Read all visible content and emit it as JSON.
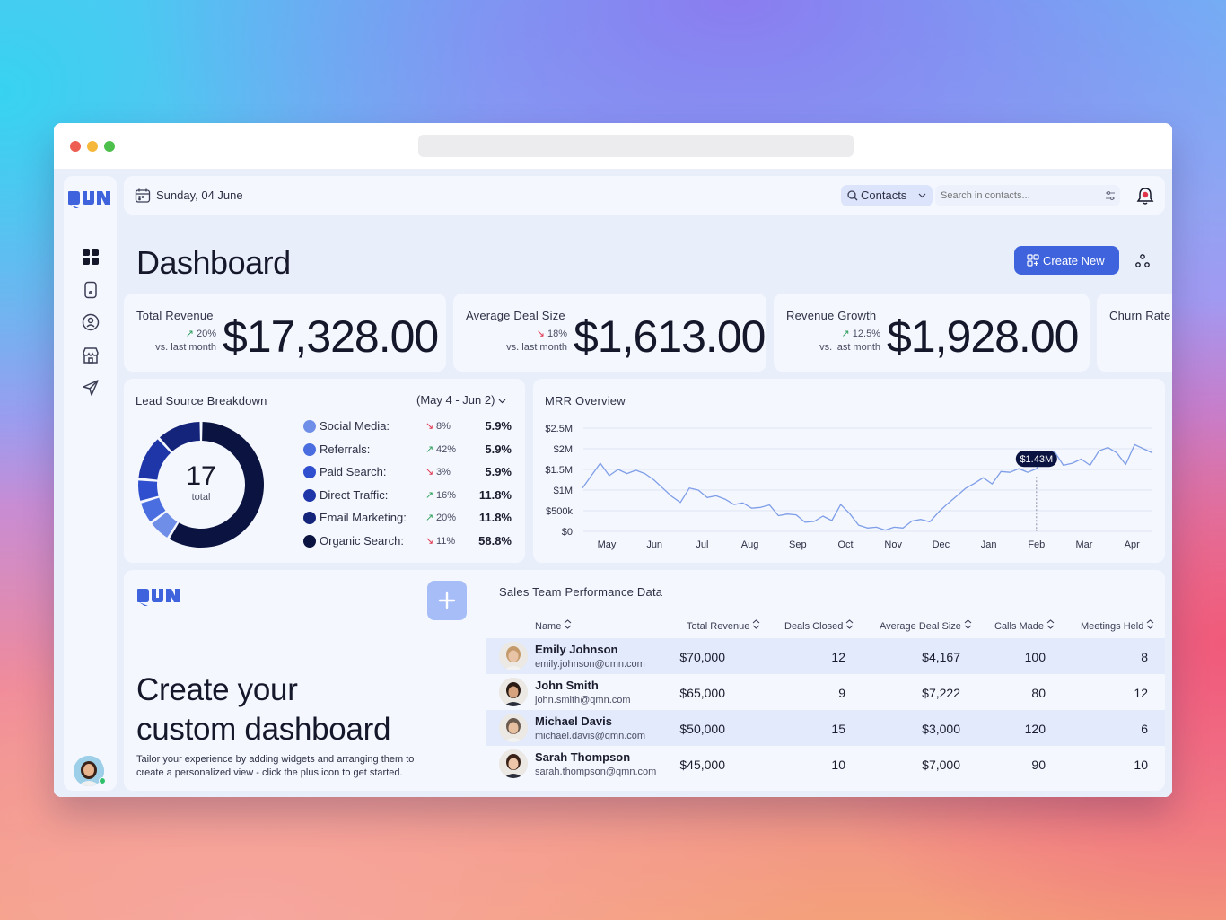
{
  "header": {
    "date": "Sunday, 04 June",
    "search_scope": "Contacts",
    "search_placeholder": "Search in contacts..."
  },
  "page": {
    "title": "Dashboard",
    "create_button": "Create New"
  },
  "kpis": [
    {
      "label": "Total Revenue",
      "change": "20%",
      "direction": "up",
      "compare": "vs. last month",
      "value": "$17,328.00"
    },
    {
      "label": "Average Deal Size",
      "change": "18%",
      "direction": "down",
      "compare": "vs. last month",
      "value": "$1,613.00"
    },
    {
      "label": "Revenue Growth",
      "change": "12.5%",
      "direction": "up",
      "compare": "vs. last month",
      "value": "$1,928.00"
    },
    {
      "label": "Churn Rate"
    }
  ],
  "lead_source": {
    "title": "Lead Source Breakdown",
    "range": "(May 4 - Jun 2)",
    "total": "17",
    "total_label": "total",
    "items": [
      {
        "name": "Social Media:",
        "change": "8%",
        "direction": "down",
        "value": "5.9%",
        "color": "#6f8ee8"
      },
      {
        "name": "Referrals:",
        "change": "42%",
        "direction": "up",
        "value": "5.9%",
        "color": "#4a6ee0"
      },
      {
        "name": "Paid Search:",
        "change": "3%",
        "direction": "down",
        "value": "5.9%",
        "color": "#2f4fcf"
      },
      {
        "name": "Direct Traffic:",
        "change": "16%",
        "direction": "up",
        "value": "11.8%",
        "color": "#1e36a8"
      },
      {
        "name": "Email Marketing:",
        "change": "20%",
        "direction": "up",
        "value": "11.8%",
        "color": "#14247a"
      },
      {
        "name": "Organic Search:",
        "change": "11%",
        "direction": "down",
        "value": "58.8%",
        "color": "#0b1440"
      }
    ]
  },
  "mrr": {
    "title": "MRR Overview",
    "tooltip": "$1.43M"
  },
  "chart_data": {
    "type": "line",
    "title": "MRR Overview",
    "x": [
      "May",
      "Jun",
      "Jul",
      "Aug",
      "Sep",
      "Oct",
      "Nov",
      "Dec",
      "Jan",
      "Feb",
      "Mar",
      "Apr"
    ],
    "yticks": [
      "$2.5M",
      "$2M",
      "$1.5M",
      "$1M",
      "$500k",
      "$0"
    ],
    "ylim": [
      0,
      2500000
    ],
    "values": [
      1050000,
      1350000,
      1650000,
      1350000,
      1500000,
      1400000,
      1480000,
      1400000,
      1250000,
      1050000,
      850000,
      700000,
      1050000,
      1000000,
      820000,
      860000,
      780000,
      650000,
      690000,
      560000,
      580000,
      640000,
      380000,
      420000,
      400000,
      220000,
      240000,
      370000,
      260000,
      650000,
      430000,
      150000,
      80000,
      100000,
      30000,
      100000,
      80000,
      250000,
      290000,
      230000,
      470000,
      670000,
      850000,
      1040000,
      1160000,
      1300000,
      1150000,
      1450000,
      1430000,
      1520000,
      1430000,
      1520000,
      1930000,
      1930000,
      1600000,
      1650000,
      1750000,
      1600000,
      1950000,
      2030000,
      1900000,
      1620000,
      2100000,
      2000000,
      1900000
    ],
    "highlight": {
      "x": "Feb",
      "value": "$1.43M"
    }
  },
  "promo": {
    "title_line1": "Create your",
    "title_line2": "custom dashboard",
    "desc": "Tailor your experience by adding widgets and arranging them to create a personalized view - click the plus icon to get started."
  },
  "sales_table": {
    "title": "Sales Team Performance Data",
    "columns": [
      "Name",
      "Total Revenue",
      "Deals Closed",
      "Average Deal Size",
      "Calls Made",
      "Meetings Held"
    ],
    "rows": [
      {
        "name": "Emily Johnson",
        "email": "emily.johnson@qmn.com",
        "revenue": "$70,000",
        "deals": "12",
        "avg": "$4,167",
        "calls": "100",
        "meetings": "8"
      },
      {
        "name": "John Smith",
        "email": "john.smith@qmn.com",
        "revenue": "$65,000",
        "deals": "9",
        "avg": "$7,222",
        "calls": "80",
        "meetings": "12"
      },
      {
        "name": "Michael Davis",
        "email": "michael.davis@qmn.com",
        "revenue": "$50,000",
        "deals": "15",
        "avg": "$3,000",
        "calls": "120",
        "meetings": "6"
      },
      {
        "name": "Sarah Thompson",
        "email": "sarah.thompson@qmn.com",
        "revenue": "$45,000",
        "deals": "10",
        "avg": "$7,000",
        "calls": "90",
        "meetings": "10"
      }
    ]
  },
  "colors": {
    "accent": "#3e63dd",
    "navy": "#0b1440",
    "up": "#2e9e5b",
    "down": "#e0344a"
  }
}
